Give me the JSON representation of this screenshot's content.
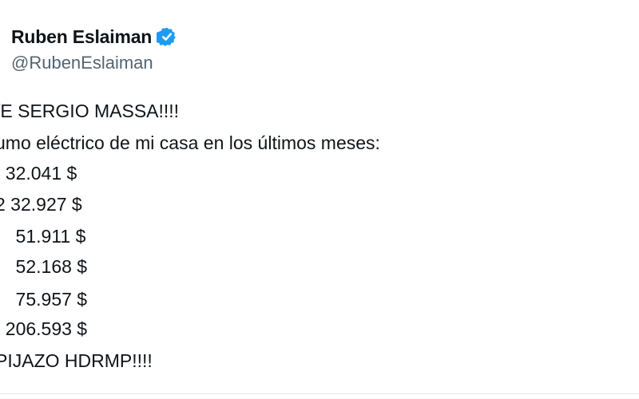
{
  "tweet": {
    "author": {
      "display_name": "Ruben Eslaiman",
      "handle": "@RubenEslaiman",
      "verified_icon": "verified-badge-icon",
      "verified_color": "#1d9bf0"
    },
    "lines": [
      "/E SERGIO MASSA!!!!",
      "umo eléctrico de mi casa en los últimos meses:",
      "  32.041 $",
      "2 32.927 $",
      "    51.911 $",
      "    52.168 $",
      "    75.957 $",
      "  206.593 $",
      "PIJAZO HDRMP!!!!"
    ]
  }
}
